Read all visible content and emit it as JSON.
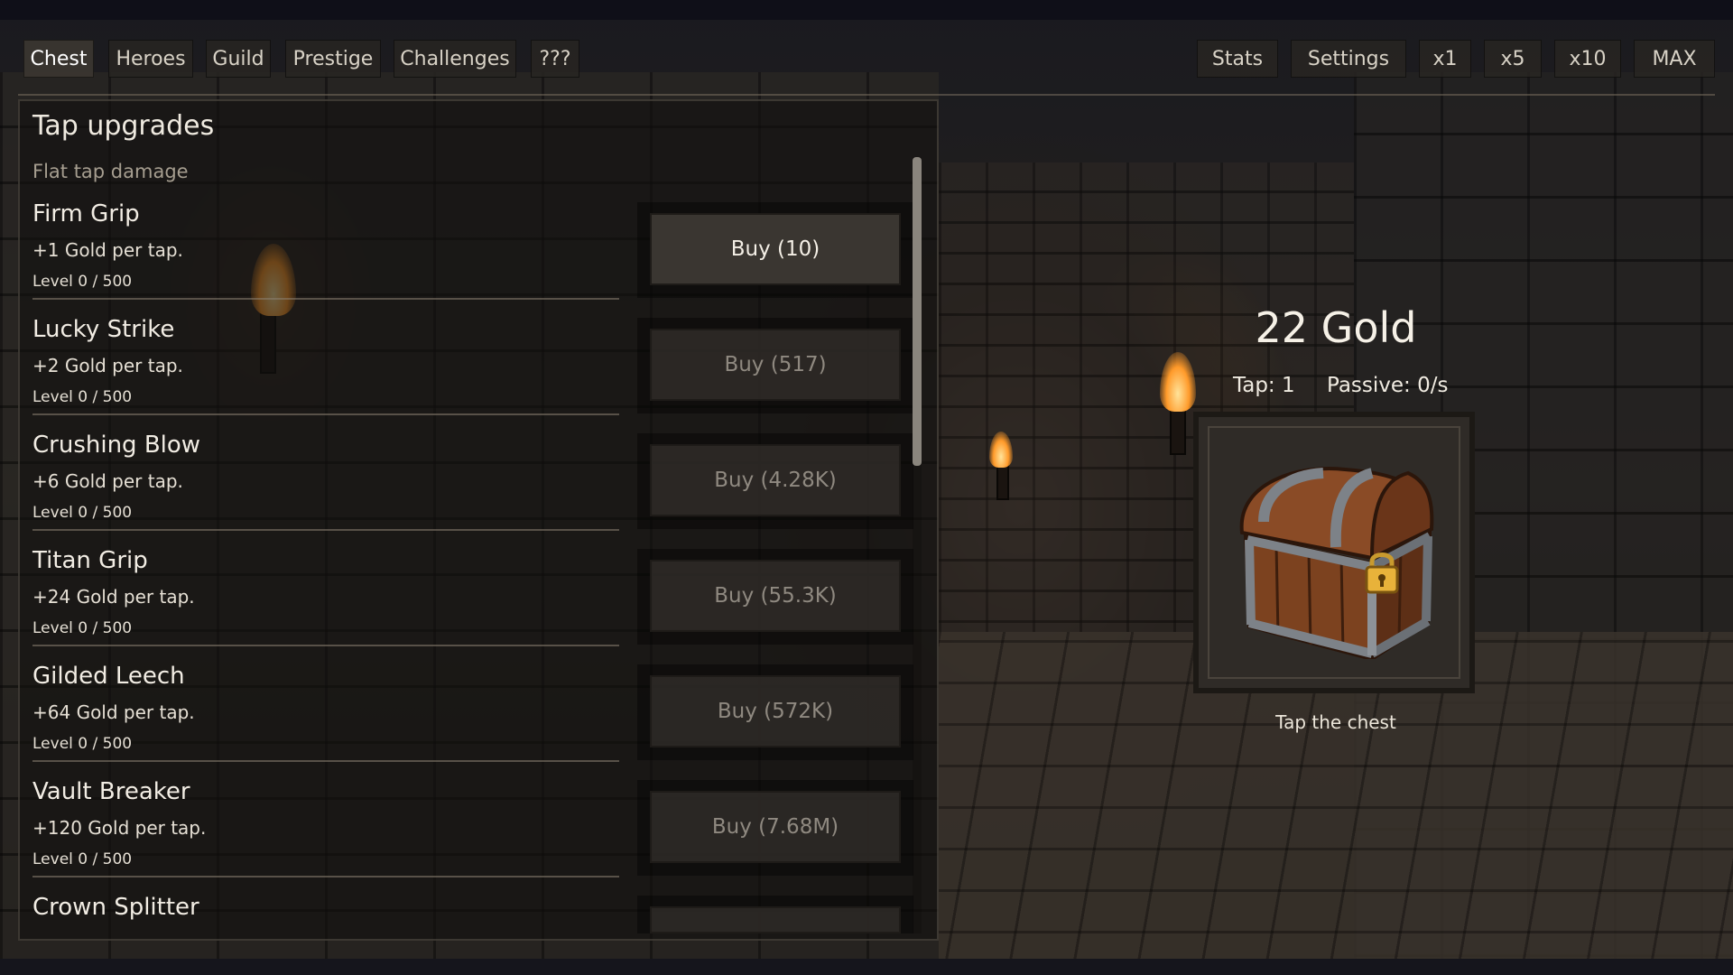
{
  "tabs_left": [
    {
      "label": "Chest",
      "active": true
    },
    {
      "label": "Heroes",
      "active": false
    },
    {
      "label": "Guild",
      "active": false
    },
    {
      "label": "Prestige",
      "active": false
    },
    {
      "label": "Challenges",
      "active": false
    },
    {
      "label": "???",
      "active": false
    }
  ],
  "tabs_right": {
    "stats": "Stats",
    "settings": "Settings",
    "multipliers": [
      "x1",
      "x5",
      "x10",
      "MAX"
    ]
  },
  "panel": {
    "title": "Tap upgrades",
    "subtitle": "Flat tap damage",
    "upgrades": [
      {
        "name": "Firm Grip",
        "desc": "+1 Gold per tap.",
        "level": "Level 0 / 500",
        "buy": "Buy (10)",
        "affordable": true
      },
      {
        "name": "Lucky Strike",
        "desc": "+2 Gold per tap.",
        "level": "Level 0 / 500",
        "buy": "Buy (517)",
        "affordable": false
      },
      {
        "name": "Crushing Blow",
        "desc": "+6 Gold per tap.",
        "level": "Level 0 / 500",
        "buy": "Buy (4.28K)",
        "affordable": false
      },
      {
        "name": "Titan Grip",
        "desc": "+24 Gold per tap.",
        "level": "Level 0 / 500",
        "buy": "Buy (55.3K)",
        "affordable": false
      },
      {
        "name": "Gilded Leech",
        "desc": "+64 Gold per tap.",
        "level": "Level 0 / 500",
        "buy": "Buy (572K)",
        "affordable": false
      },
      {
        "name": "Vault Breaker",
        "desc": "+120 Gold per tap.",
        "level": "Level 0 / 500",
        "buy": "Buy (7.68M)",
        "affordable": false
      },
      {
        "name": "Crown Splitter"
      }
    ]
  },
  "hud": {
    "gold": "22 Gold",
    "tap": "Tap: 1",
    "passive": "Passive: 0/s",
    "chest_caption": "Tap the chest"
  },
  "colors": {
    "text_primary": "#f2ede4",
    "text_muted": "#a69e90",
    "button_bg": "#3a3631",
    "button_disabled_text": "#8f8980",
    "chest_wood": "#8a4b26",
    "chest_metal": "#7d8288",
    "chest_gold": "#e8b23a"
  },
  "icons": {
    "chest": "treasure-chest-icon",
    "padlock": "padlock-icon",
    "torch": "torch-icon"
  }
}
